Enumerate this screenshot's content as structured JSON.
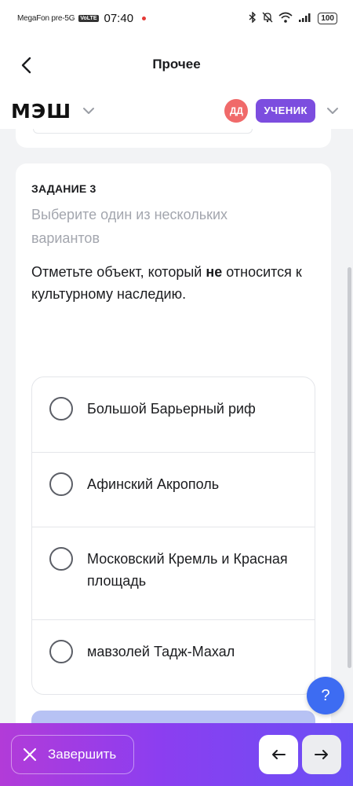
{
  "status_bar": {
    "carrier": "MegaFon pre-5G",
    "volte": "VoLTE",
    "time": "07:40",
    "battery": "100"
  },
  "header": {
    "title": "Прочее"
  },
  "brand": {
    "logo": "МЭШ",
    "avatar_initials": "ДД",
    "role": "УЧЕНИК"
  },
  "task": {
    "label": "ЗАДАНИЕ 3",
    "hint": "Выберите один из нескольких вариантов",
    "question_before": "Отметьте объект, который ",
    "question_bold": "не",
    "question_after": " относится к культурному наследию.",
    "options": [
      "Большой Барьерный риф",
      "Афинский Акрополь",
      "Московский Кремль и Красная площадь",
      "мавзолей Тадж-Махал"
    ]
  },
  "help": {
    "label": "?"
  },
  "bottom_bar": {
    "finish_label": "Завершить"
  },
  "colors": {
    "accent_purple": "#7c4ddf",
    "avatar_red": "#f06a6a",
    "help_blue": "#3d6cf2",
    "gradient_start": "#b23bd8",
    "gradient_end": "#6a4ff5"
  }
}
